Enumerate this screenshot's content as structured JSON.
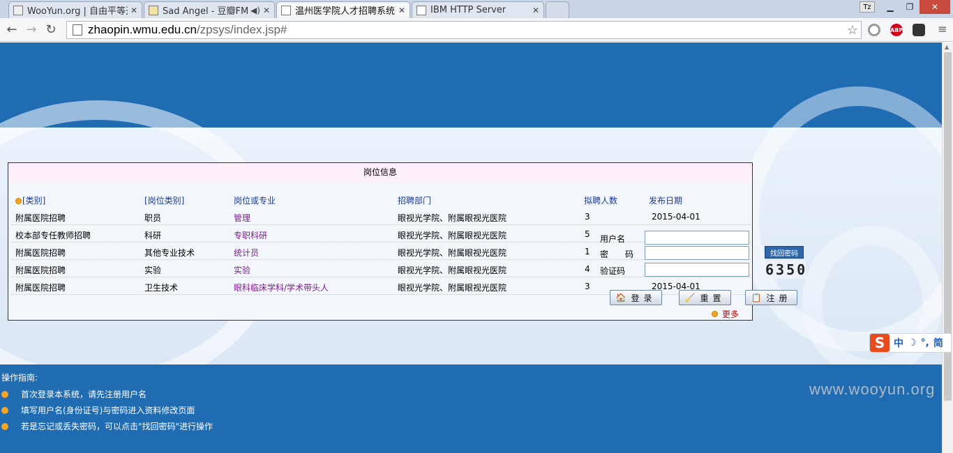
{
  "browser": {
    "tabs": [
      {
        "title": "WooYun.org | 自由平等开",
        "active": false
      },
      {
        "title": "Sad Angel - 豆瓣FM",
        "active": false
      },
      {
        "title": "温州医学院人才招聘系统",
        "active": true
      },
      {
        "title": "IBM HTTP Server",
        "active": false
      }
    ],
    "profile": "Tz",
    "url_host": "zhaopin.wmu.edu.cn",
    "url_path": "/zpsys/index.jsp#",
    "ext_abp": "ABP"
  },
  "panel": {
    "title": "岗位信息",
    "columns": [
      "[类别]",
      "[岗位类别]",
      "岗位或专业",
      "招聘部门",
      "拟聘人数",
      "发布日期"
    ],
    "rows": [
      {
        "category": "附属医院招聘",
        "post_type": "职员",
        "major": "管理",
        "dept": "眼视光学院、附属眼视光医院",
        "count": "3",
        "date": "2015-04-01"
      },
      {
        "category": "校本部专任教师招聘",
        "post_type": "科研",
        "major": "专职科研",
        "dept": "眼视光学院、附属眼视光医院",
        "count": "5",
        "date": ""
      },
      {
        "category": "附属医院招聘",
        "post_type": "其他专业技术",
        "major": "统计员",
        "dept": "眼视光学院、附属眼视光医院",
        "count": "1",
        "date": ""
      },
      {
        "category": "附属医院招聘",
        "post_type": "实验",
        "major": "实验",
        "dept": "眼视光学院、附属眼视光医院",
        "count": "4",
        "date": ""
      },
      {
        "category": "附属医院招聘",
        "post_type": "卫生技术",
        "major": "眼科临床学科/学术带头人",
        "dept": "眼视光学院、附属眼视光医院",
        "count": "3",
        "date": "2015-04-01"
      }
    ],
    "more": "更多"
  },
  "login": {
    "username_label": "用户名",
    "password_label": "密　　码",
    "captcha_label": "验证码",
    "find_password": "找回密码",
    "captcha_code": "6350",
    "login_btn": "登录",
    "reset_btn": "重置",
    "register_btn": "注册"
  },
  "guide": {
    "title": "操作指南:",
    "items": [
      "首次登录本系统，请先注册用户名",
      "填写用户名(身份证号)与密码进入资料修改页面",
      "若是忘记或丢失密码，可以点击\"找回密码\"进行操作"
    ]
  },
  "ime": {
    "mode": "中",
    "extra": "简"
  },
  "watermark": "www.wooyun.org"
}
